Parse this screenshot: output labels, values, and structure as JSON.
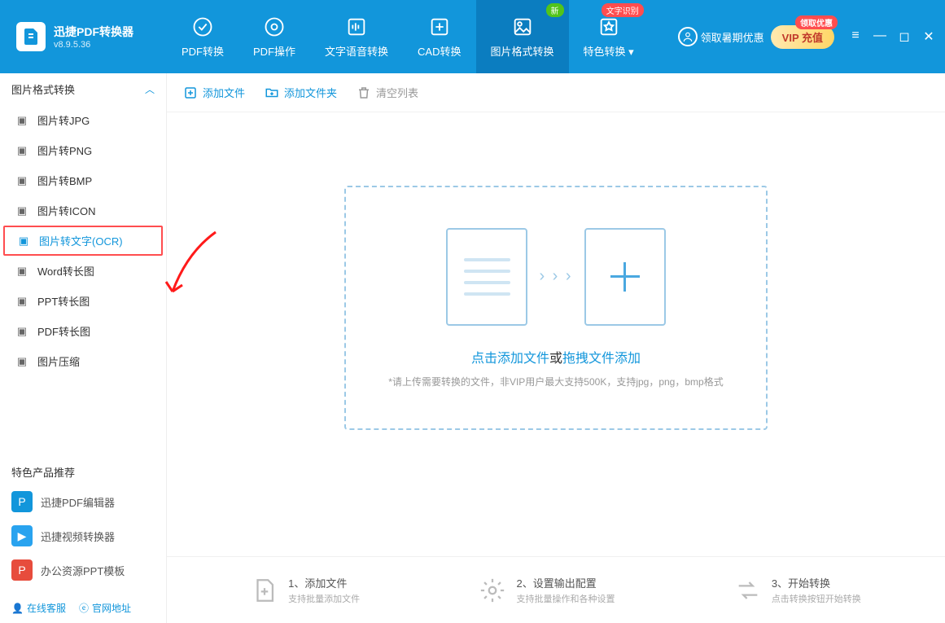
{
  "app": {
    "name": "迅捷PDF转换器",
    "version": "v8.9.5.36"
  },
  "nav": {
    "tabs": [
      {
        "label": "PDF转换"
      },
      {
        "label": "PDF操作"
      },
      {
        "label": "文字语音转换"
      },
      {
        "label": "CAD转换"
      },
      {
        "label": "图片格式转换",
        "badge": "新",
        "badge_color": "green"
      },
      {
        "label": "特色转换",
        "badge": "文字识别",
        "badge_color": "red",
        "dropdown": true
      }
    ]
  },
  "header_right": {
    "coupon": "领取暑期优惠",
    "vip_badge": "领取优惠",
    "vip_label": "VIP 充值"
  },
  "sidebar": {
    "section_title": "图片格式转换",
    "items": [
      {
        "label": "图片转JPG"
      },
      {
        "label": "图片转PNG"
      },
      {
        "label": "图片转BMP"
      },
      {
        "label": "图片转ICON"
      },
      {
        "label": "图片转文字(OCR)",
        "selected": true
      },
      {
        "label": "Word转长图"
      },
      {
        "label": "PPT转长图"
      },
      {
        "label": "PDF转长图"
      },
      {
        "label": "图片压缩"
      }
    ],
    "recommend_title": "特色产品推荐",
    "recommend": [
      {
        "label": "迅捷PDF编辑器"
      },
      {
        "label": "迅捷视频转换器"
      },
      {
        "label": "办公资源PPT模板"
      }
    ],
    "footer": {
      "service": "在线客服",
      "site": "官网地址"
    }
  },
  "toolbar": {
    "add_file": "添加文件",
    "add_folder": "添加文件夹",
    "clear": "清空列表"
  },
  "dropzone": {
    "click_add": "点击添加文件",
    "or": "或",
    "drag_add": "拖拽文件添加",
    "hint": "*请上传需要转换的文件，非VIP用户最大支持500K，支持jpg，png，bmp格式"
  },
  "steps": [
    {
      "title": "1、添加文件",
      "sub": "支持批量添加文件"
    },
    {
      "title": "2、设置输出配置",
      "sub": "支持批量操作和各种设置"
    },
    {
      "title": "3、开始转换",
      "sub": "点击转换按钮开始转换"
    }
  ]
}
